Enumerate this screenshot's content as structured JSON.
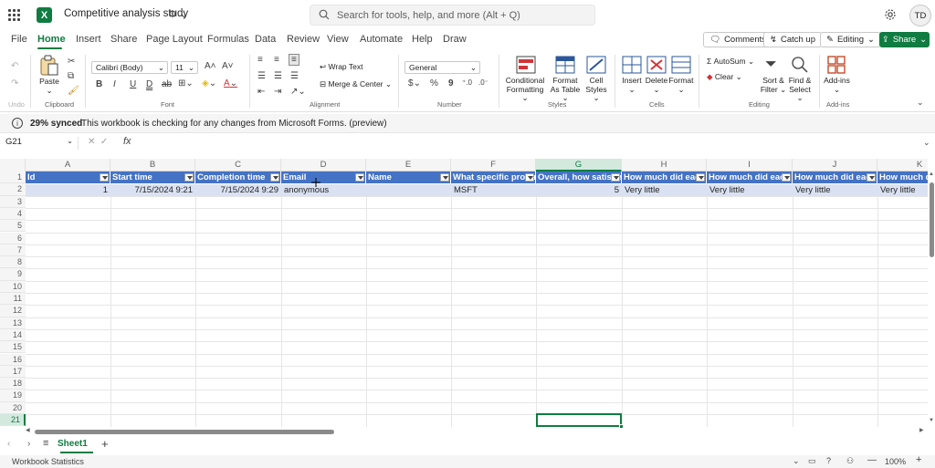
{
  "app": {
    "logo_letter": "X",
    "doc_title": "Competitive analysis study",
    "search_placeholder": "Search for tools, help, and more (Alt + Q)",
    "user_initials": "TD",
    "brand_color": "#107c41"
  },
  "menu": {
    "tabs": [
      "File",
      "Home",
      "Insert",
      "Share",
      "Page Layout",
      "Formulas",
      "Data",
      "Review",
      "View",
      "Automate",
      "Help",
      "Draw"
    ],
    "active_tab": "Home",
    "comments_label": "Comments",
    "catchup_label": "Catch up",
    "editing_label": "Editing",
    "share_label": "Share"
  },
  "ribbon": {
    "clipboard": {
      "paste": "Paste",
      "group": "Clipboard",
      "undo": "Undo"
    },
    "font": {
      "name": "Calibri (Body)",
      "size": "11",
      "group": "Font",
      "bold": "B",
      "italic": "I",
      "underline": "U",
      "double_underline": "D",
      "strike": "ab"
    },
    "alignment": {
      "wrap": "Wrap Text",
      "merge": "Merge & Center",
      "group": "Alignment"
    },
    "number": {
      "format": "General",
      "group": "Number",
      "currency": "$",
      "percent": "%",
      "comma": "9"
    },
    "styles": {
      "conditional": "Conditional Formatting",
      "format_table": "Format As Table",
      "cell_styles": "Cell Styles",
      "group": "Styles"
    },
    "cells": {
      "insert": "Insert",
      "delete": "Delete",
      "format": "Format",
      "group": "Cells"
    },
    "editing": {
      "autosum": "AutoSum",
      "clear": "Clear",
      "sort": "Sort & Filter",
      "find": "Find & Select",
      "group": "Editing"
    },
    "addins": {
      "label": "Add-ins",
      "group": "Add-ins"
    }
  },
  "notice": {
    "strong": "29% synced",
    "text": "This workbook is checking for any changes from Microsoft Forms. (preview)"
  },
  "formula_bar": {
    "name_box": "G21",
    "fx": "fx",
    "formula": ""
  },
  "sheet": {
    "columns": [
      "A",
      "B",
      "C",
      "D",
      "E",
      "F",
      "G",
      "H",
      "I",
      "J",
      "K"
    ],
    "selected_column": "G",
    "rows": [
      "1",
      "2",
      "3",
      "4",
      "5",
      "6",
      "7",
      "8",
      "9",
      "10",
      "11",
      "12",
      "13",
      "14",
      "15",
      "16",
      "17",
      "18",
      "19",
      "20",
      "21"
    ],
    "selected_row": "21",
    "header_row": [
      "Id",
      "Start time",
      "Completion time",
      "Email",
      "Name",
      "What specific produ",
      "Overall, how satisfie",
      "How much did each",
      "How much did each",
      "How much did each",
      "How much di"
    ],
    "data_row": [
      "1",
      "7/15/2024 9:21",
      "7/15/2024 9:29",
      "anonymous",
      "",
      "MSFT",
      "5",
      "Very little",
      "Very little",
      "Very little",
      "Very little"
    ],
    "header_color": "#4472c4",
    "data_color": "#d9e1f2"
  },
  "sheet_tabs": {
    "active": "Sheet1",
    "add": "+"
  },
  "status": {
    "left": "Workbook Statistics",
    "zoom": "100%"
  }
}
